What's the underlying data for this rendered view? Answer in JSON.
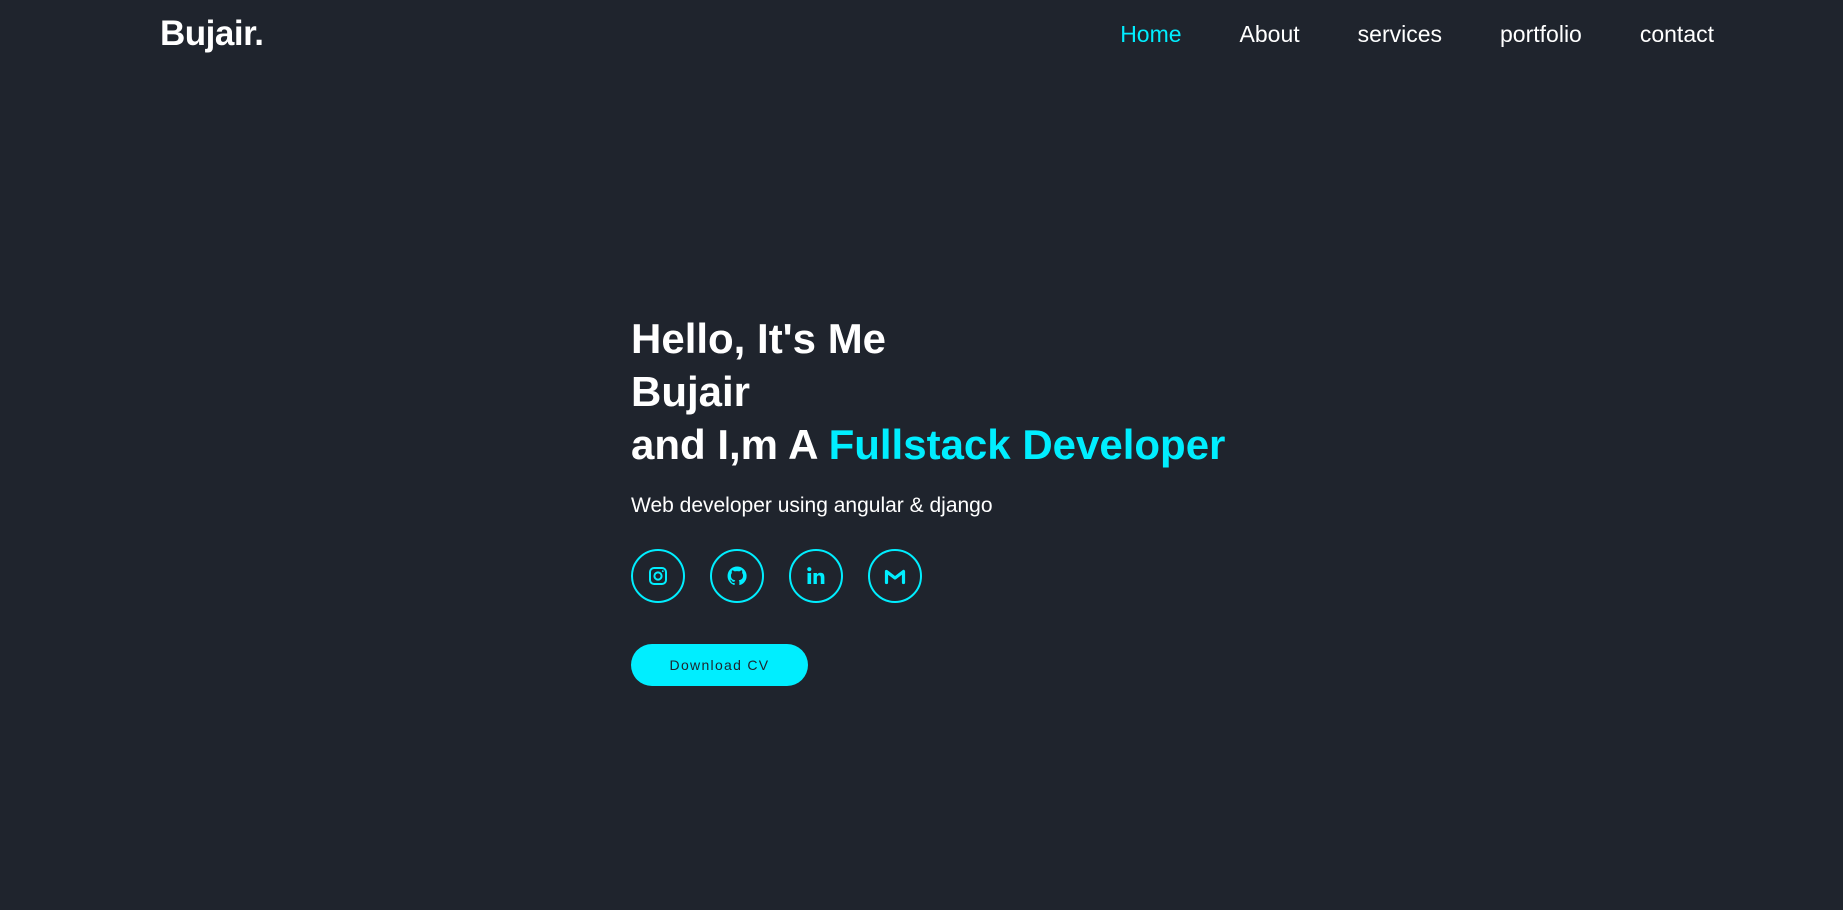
{
  "header": {
    "logo": "Bujair.",
    "nav": [
      {
        "label": "Home",
        "active": true
      },
      {
        "label": "About",
        "active": false
      },
      {
        "label": "services",
        "active": false
      },
      {
        "label": "portfolio",
        "active": false
      },
      {
        "label": "contact",
        "active": false
      }
    ]
  },
  "hero": {
    "greeting": "Hello, It's Me",
    "name": "Bujair",
    "role_prefix": "and I,m A ",
    "role_highlight": "Fullstack Developer",
    "subtitle": "Web developer using angular & django",
    "socials": [
      {
        "icon": "instagram-icon"
      },
      {
        "icon": "github-icon"
      },
      {
        "icon": "linkedin-icon"
      },
      {
        "icon": "gmail-icon"
      }
    ],
    "cta_label": "Download CV"
  },
  "colors": {
    "background": "#1f242d",
    "accent": "#00eeff",
    "text": "#ffffff"
  }
}
